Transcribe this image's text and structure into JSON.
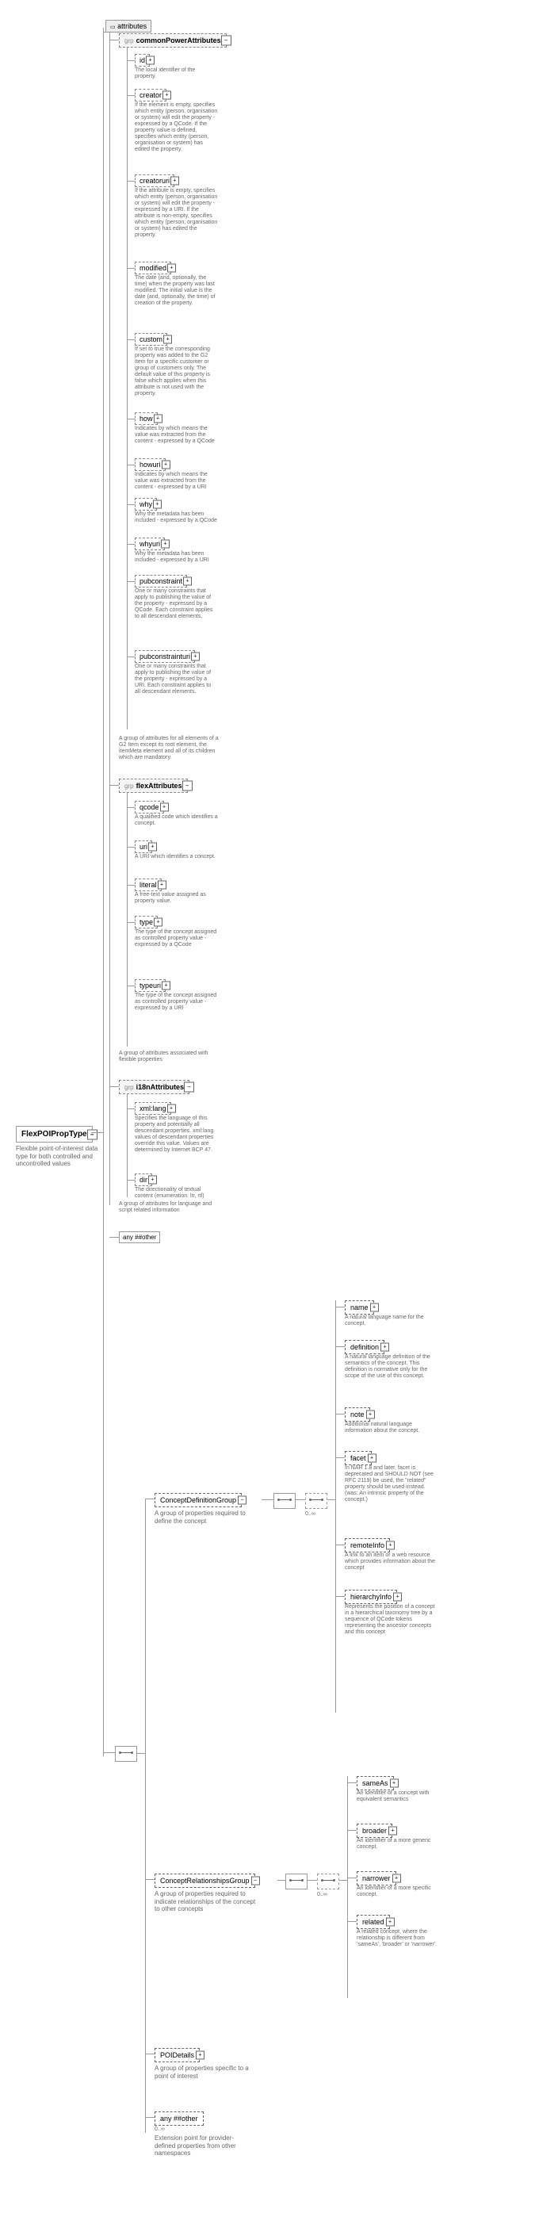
{
  "root": {
    "name": "FlexPOIPropType",
    "desc": "Flexible point-of-interest data type for both controlled and uncontrolled values"
  },
  "attrHeading": "attributes",
  "groups": {
    "common": {
      "label": "commonPowerAttributes",
      "desc": "A group of attributes for all elements of a G2 Item except its root element, the itemMeta element and all of its children which are mandatory.",
      "attrs": [
        {
          "name": "id",
          "desc": "The local identifier of the property."
        },
        {
          "name": "creator",
          "desc": "If the element is empty, specifies which entity (person, organisation or system) will edit the property - expressed by a QCode. If the property value is defined, specifies which entity (person, organisation or system) has edited the property."
        },
        {
          "name": "creatoruri",
          "desc": "If the attribute is empty, specifies which entity (person, organisation or system) will edit the property - expressed by a URI. If the attribute is non-empty, specifies which entity (person, organisation or system) has edited the property."
        },
        {
          "name": "modified",
          "desc": "The date (and, optionally, the time) when the property was last modified. The initial value is the date (and, optionally, the time) of creation of the property."
        },
        {
          "name": "custom",
          "desc": "If set to true the corresponding property was added to the G2 Item for a specific customer or group of customers only. The default value of this property is false which applies when this attribute is not used with the property."
        },
        {
          "name": "how",
          "desc": "Indicates by which means the value was extracted from the content - expressed by a QCode"
        },
        {
          "name": "howuri",
          "desc": "Indicates by which means the value was extracted from the content - expressed by a URI"
        },
        {
          "name": "why",
          "desc": "Why the metadata has been included - expressed by a QCode"
        },
        {
          "name": "whyuri",
          "desc": "Why the metadata has been included - expressed by a URI"
        },
        {
          "name": "pubconstraint",
          "desc": "One or many constraints that apply to publishing the value of the property - expressed by a QCode. Each constraint applies to all descendant elements."
        },
        {
          "name": "pubconstrainturi",
          "desc": "One or many constraints that apply to publishing the value of the property - expressed by a URI. Each constraint applies to all descendant elements."
        }
      ]
    },
    "flex": {
      "label": "flexAttributes",
      "desc": "A group of attributes associated with flexible properties",
      "attrs": [
        {
          "name": "qcode",
          "desc": "A qualified code which identifies a concept."
        },
        {
          "name": "uri",
          "desc": "A URI which identifies a concept."
        },
        {
          "name": "literal",
          "desc": "A free-text value assigned as property value."
        },
        {
          "name": "type",
          "desc": "The type of the concept assigned as controlled property value - expressed by a QCode"
        },
        {
          "name": "typeuri",
          "desc": "The type of the concept assigned as controlled property value - expressed by a URI"
        }
      ]
    },
    "i18n": {
      "label": "i18nAttributes",
      "desc": "A group of attributes for language and script related information",
      "attrs": [
        {
          "name": "xml:lang",
          "desc": "Specifies the language of this property and potentially all descendant properties. xml:lang values of descendant properties override this value. Values are determined by Internet BCP 47."
        },
        {
          "name": "dir",
          "desc": "The directionality of textual content (enumeration: ltr, rtl)"
        }
      ]
    }
  },
  "anyOther": "any ##other",
  "defGroup": {
    "label": "ConceptDefinitionGroup",
    "desc": "A group of properties required to define the concept",
    "elements": [
      {
        "name": "name",
        "desc": "A natural language name for the concept."
      },
      {
        "name": "definition",
        "desc": "A natural language definition of the semantics of the concept. This definition is normative only for the scope of the use of this concept."
      },
      {
        "name": "note",
        "desc": "Additional natural language information about the concept."
      },
      {
        "name": "facet",
        "desc": "In NAR 1.8 and later, facet is deprecated and SHOULD NOT (see RFC 2119) be used, the \"related\" property should be used instead. (was: An intrinsic property of the concept.)"
      },
      {
        "name": "remoteInfo",
        "desc": "A link to an item or a web resource which provides information about the concept"
      },
      {
        "name": "hierarchyInfo",
        "desc": "Represents the position of a concept in a hierarchical taxonomy tree by a sequence of QCode tokens representing the ancestor concepts and this concept"
      }
    ]
  },
  "relGroup": {
    "label": "ConceptRelationshipsGroup",
    "desc": "A group of properties required to indicate relationships of the concept to other concepts",
    "elements": [
      {
        "name": "sameAs",
        "desc": "An identifier of a concept with equivalent semantics"
      },
      {
        "name": "broader",
        "desc": "An identifier of a more generic concept."
      },
      {
        "name": "narrower",
        "desc": "An identifier of a more specific concept."
      },
      {
        "name": "related",
        "desc": "A related concept, where the relationship is different from 'sameAs', 'broader' or 'narrower'."
      }
    ]
  },
  "poi": {
    "label": "POIDetails",
    "desc": "A group of properties specific to a point of interest"
  },
  "anyOtherBottom": {
    "label": "any ##other",
    "occur": "0..∞",
    "desc": "Extension point for provider-defined properties from other namespaces"
  },
  "occur0inf": "0..∞",
  "grpPrefix": "grp"
}
